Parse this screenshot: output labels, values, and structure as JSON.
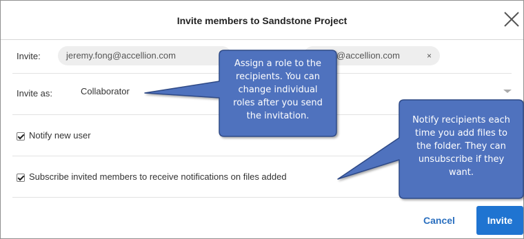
{
  "dialog": {
    "title": "Invite members to Sandstone Project",
    "invite_label": "Invite:",
    "recipients": [
      {
        "email": "jeremy.fong@accellion.com"
      },
      {
        "email": "@accellion.com",
        "remove": "×"
      }
    ],
    "invite_as_label": "Invite as:",
    "role_value": "Collaborator",
    "notify_new_user": {
      "label": "Notify new user",
      "checked": true
    },
    "subscribe": {
      "label": "Subscribe invited members to receive notifications on files added",
      "checked": true
    },
    "cancel_label": "Cancel",
    "invite_button_label": "Invite",
    "accent_color": "#1f74d1"
  },
  "callouts": {
    "role": [
      "Assign a role to the",
      "recipients. You can",
      "change individual",
      "roles after you send",
      "the invitation."
    ],
    "notify": [
      "Notify recipients each",
      "time you add files to",
      "the folder. They can",
      "unsubscribe if they",
      "want."
    ],
    "fill_color": "#4f72be"
  }
}
